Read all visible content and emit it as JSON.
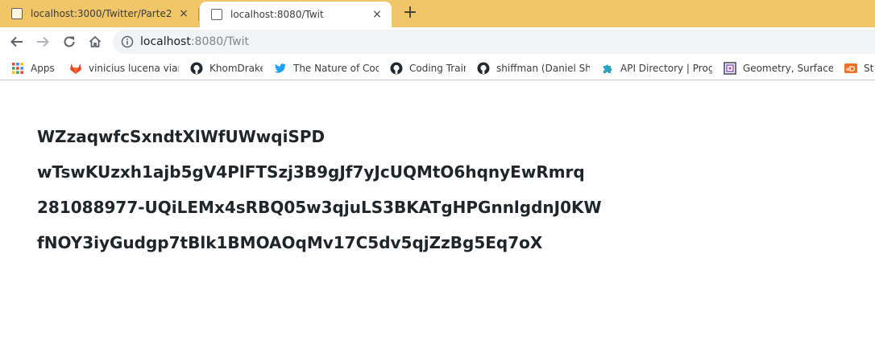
{
  "tabs": [
    {
      "title": "localhost:3000/Twitter/Parte2",
      "close": "×"
    },
    {
      "title": "localhost:8080/Twit",
      "close": "×"
    }
  ],
  "new_tab_label": "+",
  "address": {
    "host": "localhost",
    "rest": ":8080/Twit"
  },
  "bookmarks": [
    {
      "label": "Apps",
      "icon": "apps-grid-icon"
    },
    {
      "label": "vinicius lucena viana",
      "icon": "gitlab-icon"
    },
    {
      "label": "KhomDrake",
      "icon": "github-icon"
    },
    {
      "label": "The Nature of Code",
      "icon": "twitter-icon"
    },
    {
      "label": "Coding Train",
      "icon": "github-icon"
    },
    {
      "label": "shiffman (Daniel Shiffi",
      "icon": "github-icon"
    },
    {
      "label": "API Directory | Progra",
      "icon": "puzzle-icon"
    },
    {
      "label": "Geometry, Surfaces, C",
      "icon": "geometry-icon"
    },
    {
      "label": "St",
      "icon": "soundcloud-icon"
    }
  ],
  "content_lines": [
    "WZzaqwfcSxndtXlWfUWwqiSPD",
    "wTswKUzxh1ajb5gV4PlFTSzj3B9gJf7yJcUQMtO6hqnyEwRmrq",
    "281088977-UQiLEMx4sRBQ05w3qjuLS3BKATgHPGnnlgdnJ0KW",
    "fNOY3iyGudgp7tBlk1BMOAOqMv17C5dv5qjZzBg5Eq7oX"
  ],
  "colors": {
    "tabstrip": "#f1c668",
    "text": "#212529",
    "gitlab": "#e24329",
    "twitter": "#1da1f2",
    "puzzle": "#2aa3bf",
    "soundcloud": "#f26f23"
  }
}
